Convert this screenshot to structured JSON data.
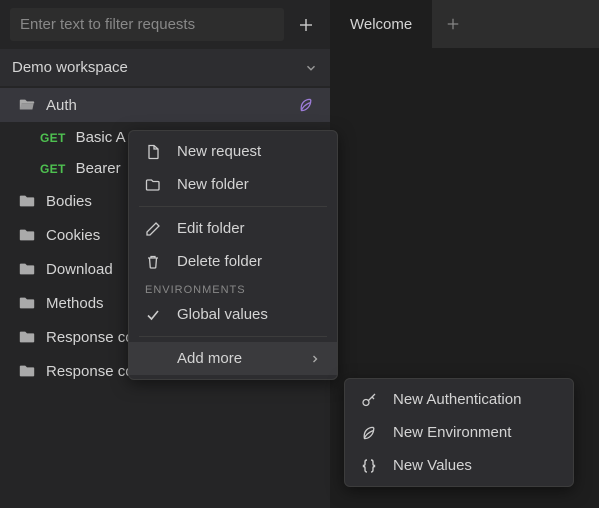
{
  "filter": {
    "placeholder": "Enter text to filter requests"
  },
  "workspace": {
    "name": "Demo workspace"
  },
  "tree": {
    "auth": {
      "label": "Auth",
      "children": [
        {
          "method": "GET",
          "label": "Basic A"
        },
        {
          "method": "GET",
          "label": "Bearer "
        }
      ]
    },
    "bodies": {
      "label": "Bodies"
    },
    "cookies": {
      "label": "Cookies"
    },
    "download": {
      "label": "Download"
    },
    "methods": {
      "label": "Methods"
    },
    "response_codes": {
      "label": "Response codes"
    },
    "response_contents": {
      "label": "Response contents"
    }
  },
  "menu": {
    "new_request": "New request",
    "new_folder": "New folder",
    "edit_folder": "Edit folder",
    "delete_folder": "Delete folder",
    "environments_header": "ENVIRONMENTS",
    "global_values": "Global values",
    "add_more": "Add more",
    "sub": {
      "new_auth": "New Authentication",
      "new_env": "New Environment",
      "new_values": "New Values"
    }
  },
  "tabs": {
    "welcome": "Welcome"
  }
}
